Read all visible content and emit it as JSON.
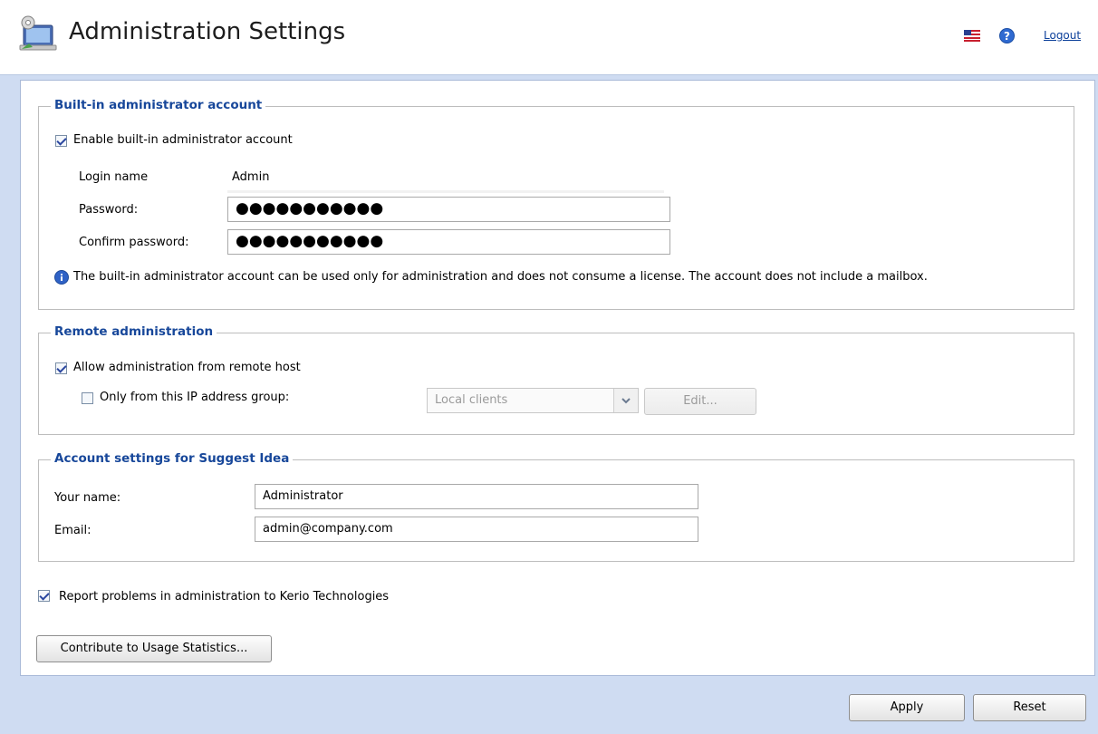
{
  "header": {
    "title": "Administration Settings",
    "logout_label": "Logout",
    "app_icon": "admin-settings-icon",
    "flag_icon": "us-flag-icon",
    "help_icon": "help-icon"
  },
  "builtin_admin": {
    "legend": "Built-in administrator account",
    "enable_label": "Enable built-in administrator account",
    "enable_checked": true,
    "login_name_label": "Login name",
    "login_name_value": "Admin",
    "password_label": "Password:",
    "password_value": "●●●●●●●●●●●",
    "confirm_label": "Confirm password:",
    "confirm_value": "●●●●●●●●●●●",
    "info_text": "The built-in administrator account can be used only for administration and does not consume a license. The account does not include a mailbox."
  },
  "remote_admin": {
    "legend": "Remote administration",
    "allow_label": "Allow administration from remote host",
    "allow_checked": true,
    "only_ip_label": "Only from this IP address group:",
    "only_ip_checked": false,
    "ip_group_value": "Local clients",
    "edit_label": "Edit..."
  },
  "suggest_idea": {
    "legend": "Account settings for Suggest Idea",
    "name_label": "Your name:",
    "name_value": "Administrator",
    "email_label": "Email:",
    "email_value": "admin@company.com"
  },
  "report": {
    "label": "Report problems in administration to Kerio Technologies",
    "checked": true
  },
  "usage_button_label": "Contribute to Usage Statistics...",
  "footer": {
    "apply_label": "Apply",
    "reset_label": "Reset"
  },
  "colors": {
    "accent": "#17479a",
    "background": "#cfdcf2"
  }
}
